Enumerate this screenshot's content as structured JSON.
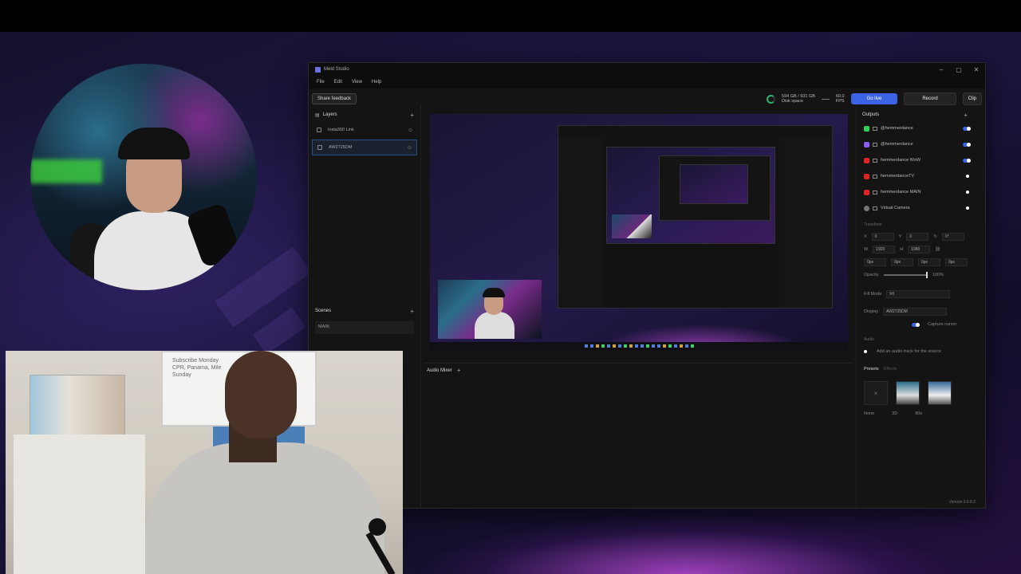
{
  "window": {
    "title": "Meld Studio",
    "controls": [
      "–",
      "▢",
      "✕"
    ]
  },
  "menu": [
    "File",
    "Edit",
    "View",
    "Help"
  ],
  "toolbar": {
    "feedback_label": "Share feedback",
    "disk_value": "594 GB / 931 GB",
    "disk_label": "Disk space",
    "fps_value": "60.0",
    "fps_label": "FPS",
    "golive_label": "Go live",
    "record_label": "Record",
    "clip_label": "Clip"
  },
  "layers": {
    "title": "Layers",
    "items": [
      {
        "label": "Insta360 Link",
        "selected": false
      },
      {
        "label": "AW2725DM",
        "selected": true
      }
    ]
  },
  "scenes": {
    "title": "Scenes",
    "items": [
      "MAIN"
    ]
  },
  "audio_mixer": {
    "title": "Audio Mixer"
  },
  "outputs": {
    "title": "Outputs",
    "items": [
      {
        "label": "@hemmerdance",
        "icon": "green",
        "toggle": true
      },
      {
        "label": "@hemmerdance",
        "icon": "purple",
        "toggle": true
      },
      {
        "label": "hemmerdance WoW",
        "icon": "red",
        "toggle": true
      },
      {
        "label": "hemmerdanceTV",
        "icon": "red",
        "toggle": false
      },
      {
        "label": "hemmerdance MAIN",
        "icon": "red",
        "toggle": false
      },
      {
        "label": "Virtual Camera",
        "icon": "grey",
        "toggle": false
      }
    ]
  },
  "properties": {
    "transform_label": "Transform",
    "x": "0",
    "y": "0",
    "rotation": "0°",
    "w": "1920",
    "h": "1080",
    "edges": [
      "0px",
      "0px",
      "0px",
      "0px"
    ],
    "opacity_label": "Opacity",
    "opacity_value": "100%",
    "opacity_fraction": 1.0,
    "fill_mode_label": "Fill Mode",
    "fill_mode_value": "Fit",
    "display_label": "Display",
    "display_value": "AW2725DM",
    "capture_cursor_label": "Capture cursor",
    "audio_label": "Audio",
    "audio_hint": "Add an audio track for the source",
    "presets_tab": "Presets",
    "effects_tab": "Effects",
    "presets": [
      {
        "label": "None"
      },
      {
        "label": "3D"
      },
      {
        "label": "90s"
      }
    ]
  },
  "version": "Version 0.6.8.2",
  "cam2_board_text": "Subscribe Monday\nCPR, Panama, Mile\nSunday",
  "colors": {
    "accent": "#3b63e6",
    "go_live": "#3b63e6",
    "twitch": "#8b5cf6",
    "youtube": "#e02424",
    "kick": "#2fd05a"
  }
}
